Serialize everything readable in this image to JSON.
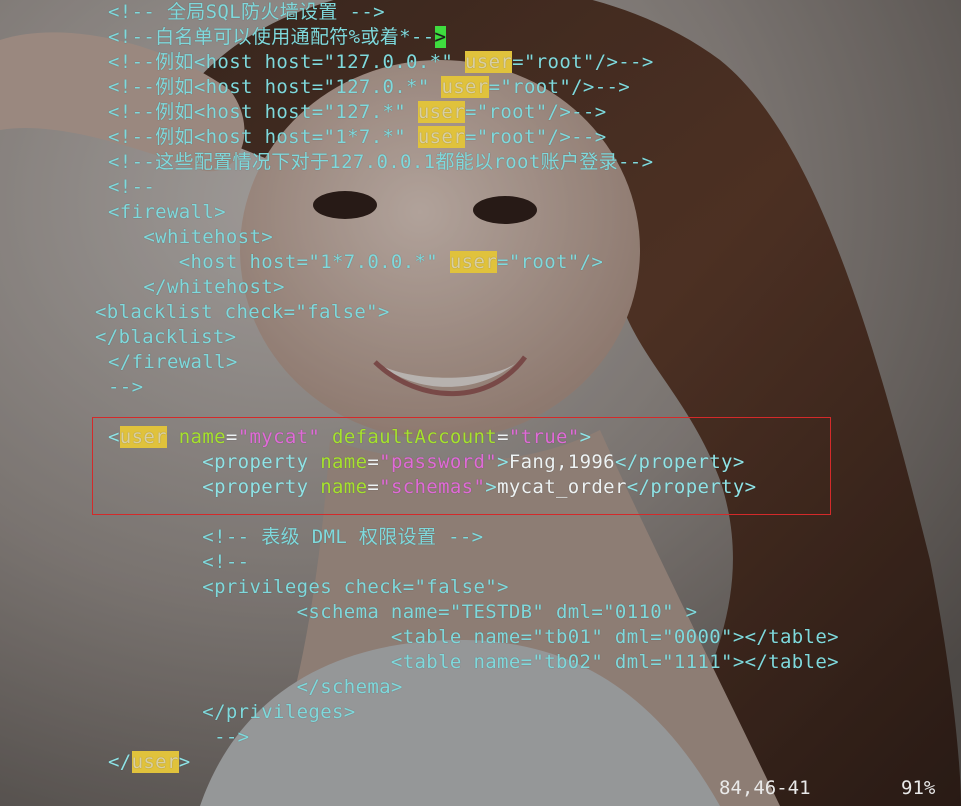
{
  "editor": {
    "lines": [
      {
        "parts": [
          {
            "k": "c",
            "t": "<!-- 全局SQL防火墙设置 -->"
          }
        ]
      },
      {
        "parts": [
          {
            "k": "c",
            "t": "<!--白名单可以使用通配符%或着*--"
          },
          {
            "k": "cur",
            "t": ">"
          }
        ]
      },
      {
        "parts": [
          {
            "k": "c",
            "t": "<!--例如<host host=\"127.0.0.*\" "
          },
          {
            "k": "hl",
            "t": "user"
          },
          {
            "k": "c",
            "t": "=\"root\"/>-->"
          }
        ]
      },
      {
        "parts": [
          {
            "k": "c",
            "t": "<!--例如<host host=\"127.0.*\" "
          },
          {
            "k": "hl",
            "t": "user"
          },
          {
            "k": "c",
            "t": "=\"root\"/>-->"
          }
        ]
      },
      {
        "parts": [
          {
            "k": "c",
            "t": "<!--例如<host host=\"127.*\" "
          },
          {
            "k": "hl",
            "t": "user"
          },
          {
            "k": "c",
            "t": "=\"root\"/>-->"
          }
        ]
      },
      {
        "parts": [
          {
            "k": "c",
            "t": "<!--例如<host host=\"1*7.*\" "
          },
          {
            "k": "hl",
            "t": "user"
          },
          {
            "k": "c",
            "t": "=\"root\"/>-->"
          }
        ]
      },
      {
        "parts": [
          {
            "k": "c",
            "t": "<!--这些配置情况下对于127.0.0.1都能以root账户登录-->"
          }
        ]
      },
      {
        "parts": [
          {
            "k": "c",
            "t": "<!--"
          }
        ]
      },
      {
        "parts": [
          {
            "k": "c",
            "t": "<firewall>"
          }
        ]
      },
      {
        "parts": [
          {
            "k": "c",
            "t": "   <whitehost>"
          }
        ]
      },
      {
        "parts": [
          {
            "k": "c",
            "t": "      <host host=\"1*7.0.0.*\" "
          },
          {
            "k": "hl",
            "t": "user"
          },
          {
            "k": "c",
            "t": "=\"root\"/>"
          }
        ]
      },
      {
        "parts": [
          {
            "k": "c",
            "t": "   </whitehost>"
          }
        ]
      },
      {
        "parts": [
          {
            "k": "c",
            "t": "<blacklist check=\"false\">"
          }
        ]
      },
      {
        "parts": [
          {
            "k": "c",
            "t": "</blacklist>"
          }
        ]
      },
      {
        "parts": [
          {
            "k": "c",
            "t": "</firewall>"
          }
        ]
      },
      {
        "parts": [
          {
            "k": "c",
            "t": "-->"
          }
        ]
      },
      {
        "parts": []
      },
      {
        "parts": [
          {
            "k": "t",
            "t": "<"
          },
          {
            "k": "hl",
            "t": "user"
          },
          {
            "k": "w",
            "t": " "
          },
          {
            "k": "a",
            "t": "name"
          },
          {
            "k": "w",
            "t": "="
          },
          {
            "k": "s",
            "t": "\"mycat\""
          },
          {
            "k": "w",
            "t": " "
          },
          {
            "k": "a",
            "t": "defaultAccount"
          },
          {
            "k": "w",
            "t": "="
          },
          {
            "k": "s",
            "t": "\"true\""
          },
          {
            "k": "t",
            "t": ">"
          }
        ]
      },
      {
        "parts": [
          {
            "k": "t",
            "t": "        <property "
          },
          {
            "k": "a",
            "t": "name"
          },
          {
            "k": "w",
            "t": "="
          },
          {
            "k": "s",
            "t": "\"password\""
          },
          {
            "k": "t",
            "t": ">"
          },
          {
            "k": "w",
            "t": "Fang,1996"
          },
          {
            "k": "t",
            "t": "</property>"
          }
        ]
      },
      {
        "parts": [
          {
            "k": "t",
            "t": "        <property "
          },
          {
            "k": "a",
            "t": "name"
          },
          {
            "k": "w",
            "t": "="
          },
          {
            "k": "s",
            "t": "\"schemas\""
          },
          {
            "k": "t",
            "t": ">"
          },
          {
            "k": "w",
            "t": "mycat_order"
          },
          {
            "k": "t",
            "t": "</property>"
          }
        ]
      },
      {
        "parts": []
      },
      {
        "parts": [
          {
            "k": "c",
            "t": "        <!-- 表级 DML 权限设置 -->"
          }
        ]
      },
      {
        "parts": [
          {
            "k": "c",
            "t": "        <!--"
          }
        ]
      },
      {
        "parts": [
          {
            "k": "c",
            "t": "        <privileges check=\"false\">"
          }
        ]
      },
      {
        "parts": [
          {
            "k": "c",
            "t": "                <schema name=\"TESTDB\" dml=\"0110\" >"
          }
        ]
      },
      {
        "parts": [
          {
            "k": "c",
            "t": "                        <table name=\"tb01\" dml=\"0000\"></table>"
          }
        ]
      },
      {
        "parts": [
          {
            "k": "c",
            "t": "                        <table name=\"tb02\" dml=\"1111\"></table>"
          }
        ]
      },
      {
        "parts": [
          {
            "k": "c",
            "t": "                </schema>"
          }
        ]
      },
      {
        "parts": [
          {
            "k": "c",
            "t": "        </privileges>"
          }
        ]
      },
      {
        "parts": [
          {
            "k": "c",
            "t": "         -->"
          }
        ]
      },
      {
        "parts": [
          {
            "k": "t",
            "t": "</"
          },
          {
            "k": "hl",
            "t": "user"
          },
          {
            "k": "t",
            "t": ">"
          }
        ]
      }
    ]
  },
  "status": {
    "position": "84,46-41",
    "percent": "91%"
  }
}
